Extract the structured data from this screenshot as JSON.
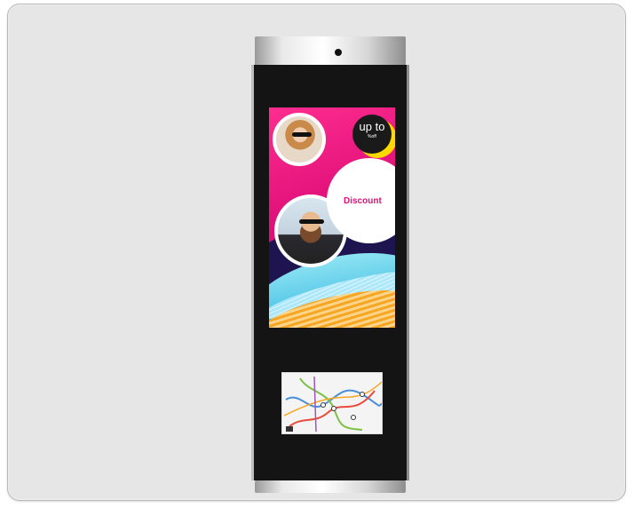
{
  "kiosk": {
    "screen": {
      "badge_main": "up to",
      "badge_sub": "%off",
      "discount_label": "Discount"
    },
    "map_label": "transit map"
  },
  "colors": {
    "background": "#e6e6e6",
    "screen_pink": "#e0107a",
    "accent_yellow": "#ffd800",
    "accent_blue": "#2aa3d8",
    "accent_orange": "#f6a623"
  }
}
